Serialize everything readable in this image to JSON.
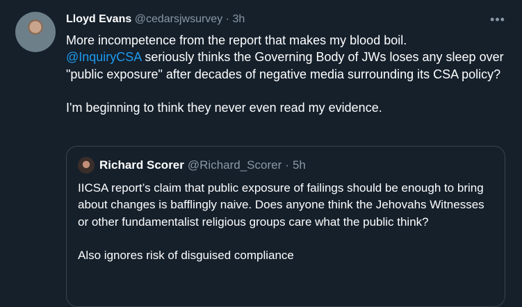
{
  "tweet": {
    "author_name": "Lloyd Evans",
    "author_handle": "@cedarsjwsurvey",
    "separator": "·",
    "time": "3h",
    "more_label": "•••",
    "lines": [
      "More incompetence from the report that makes my blood boil.",
      "seriously thinks the Governing Body of JWs loses any sleep over \"public exposure\" after decades of negative media surrounding its CSA policy?",
      "I'm beginning to think they never even read my evidence."
    ],
    "mention": "@InquiryCSA"
  },
  "quoted_tweet": {
    "author_name": "Richard Scorer",
    "author_handle": "@Richard_Scorer",
    "separator": "·",
    "time": "5h",
    "paragraphs": [
      "IICSA report’s claim that public exposure of failings should be enough to bring about changes is bafflingly naive. Does anyone think the Jehovahs Witnesses or other fundamentalist religious groups care what the public think?",
      "Also ignores risk of disguised compliance"
    ]
  },
  "colors": {
    "background": "#15202b",
    "text": "#ffffff",
    "secondary": "#8b98a5",
    "link": "#1d9bf0",
    "border": "#38444d"
  }
}
